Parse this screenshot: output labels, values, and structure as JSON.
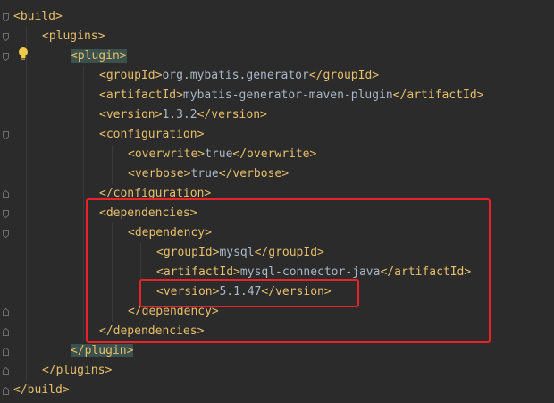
{
  "lines": [
    {
      "indent": 0,
      "parts": [
        [
          "tag",
          "<build>"
        ]
      ]
    },
    {
      "indent": 1,
      "parts": [
        [
          "tag",
          "<plugins>"
        ]
      ]
    },
    {
      "indent": 2,
      "parts": [
        [
          "tag",
          "<plugin>",
          "hl"
        ]
      ]
    },
    {
      "indent": 3,
      "parts": [
        [
          "tag",
          "<groupId>"
        ],
        [
          "txt",
          "org.mybatis.generator"
        ],
        [
          "tag",
          "</groupId>"
        ]
      ]
    },
    {
      "indent": 3,
      "parts": [
        [
          "tag",
          "<artifactId>"
        ],
        [
          "txt",
          "mybatis-generator-maven-plugin"
        ],
        [
          "tag",
          "</artifactId>"
        ]
      ]
    },
    {
      "indent": 3,
      "parts": [
        [
          "tag",
          "<version>"
        ],
        [
          "txt",
          "1.3.2"
        ],
        [
          "tag",
          "</version>"
        ]
      ]
    },
    {
      "indent": 3,
      "parts": [
        [
          "tag",
          "<configuration>"
        ]
      ]
    },
    {
      "indent": 4,
      "parts": [
        [
          "tag",
          "<overwrite>"
        ],
        [
          "txt",
          "true"
        ],
        [
          "tag",
          "</overwrite>"
        ]
      ]
    },
    {
      "indent": 4,
      "parts": [
        [
          "tag",
          "<verbose>"
        ],
        [
          "txt",
          "true"
        ],
        [
          "tag",
          "</verbose>"
        ]
      ]
    },
    {
      "indent": 3,
      "parts": [
        [
          "tag",
          "</configuration>"
        ]
      ]
    },
    {
      "indent": 3,
      "parts": [
        [
          "tag",
          "<dependencies>"
        ]
      ]
    },
    {
      "indent": 4,
      "parts": [
        [
          "tag",
          "<dependency>"
        ]
      ]
    },
    {
      "indent": 5,
      "parts": [
        [
          "tag",
          "<groupId>"
        ],
        [
          "txt",
          "mysql"
        ],
        [
          "tag",
          "</groupId>"
        ]
      ]
    },
    {
      "indent": 5,
      "parts": [
        [
          "tag",
          "<artifactId>"
        ],
        [
          "txt",
          "mysql-connector-java"
        ],
        [
          "tag",
          "</artifactId>"
        ]
      ]
    },
    {
      "indent": 5,
      "parts": [
        [
          "tag",
          "<version>"
        ],
        [
          "txt",
          "5.1.47"
        ],
        [
          "tag",
          "</version>"
        ]
      ]
    },
    {
      "indent": 4,
      "parts": [
        [
          "tag",
          "</dependency>"
        ]
      ]
    },
    {
      "indent": 3,
      "parts": [
        [
          "tag",
          "</dependencies>"
        ]
      ]
    },
    {
      "indent": 2,
      "parts": [
        [
          "tag",
          "</plugin>",
          "hl"
        ]
      ]
    },
    {
      "indent": 1,
      "parts": [
        [
          "tag",
          "</plugins>"
        ]
      ]
    },
    {
      "indent": 0,
      "parts": [
        [
          "tag",
          "</build>"
        ]
      ]
    }
  ],
  "icons": {
    "bulb": "lightbulb-icon",
    "fold": "fold-marker-icon"
  },
  "colors": {
    "background": "#2b2b2b",
    "tag": "#e8bf6a",
    "text": "#a9b7c6",
    "tag_highlight": "#3b514d",
    "annotation_box": "#e8232a"
  }
}
